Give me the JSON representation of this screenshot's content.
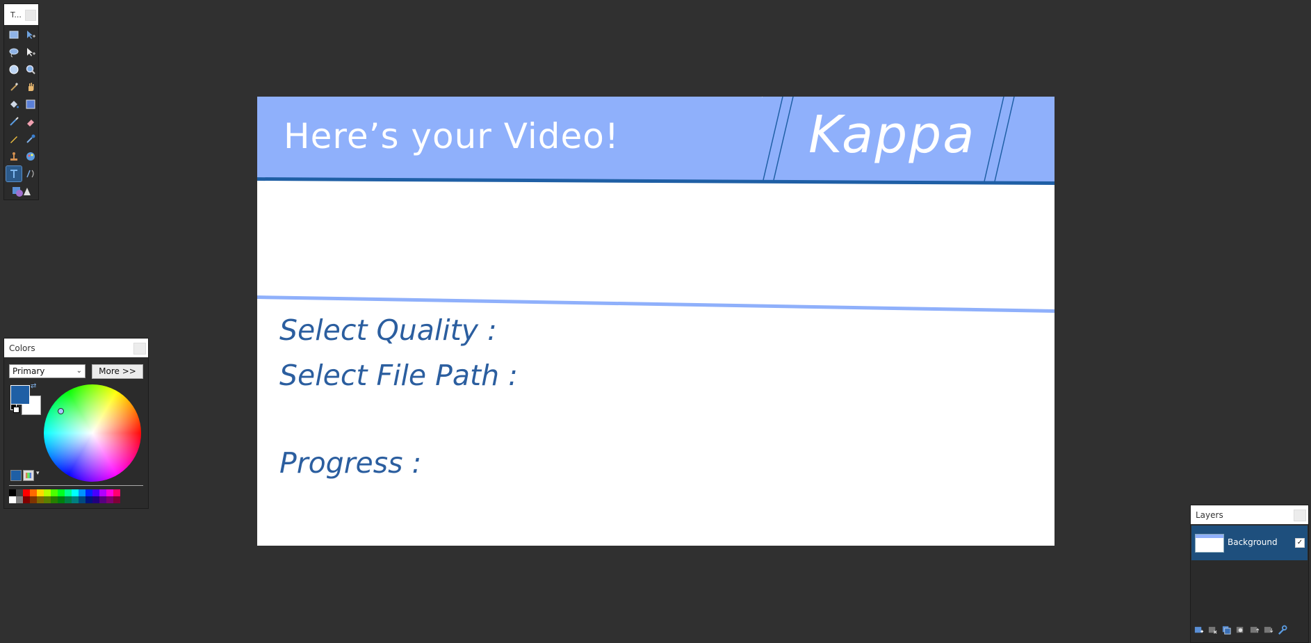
{
  "tools_window": {
    "title": "T...",
    "tools": [
      {
        "name": "rectangle-select-icon"
      },
      {
        "name": "move-selected-pixels-icon"
      },
      {
        "name": "lasso-select-icon"
      },
      {
        "name": "move-selection-icon"
      },
      {
        "name": "ellipse-select-icon"
      },
      {
        "name": "zoom-icon"
      },
      {
        "name": "magic-wand-icon"
      },
      {
        "name": "pan-icon"
      },
      {
        "name": "paint-bucket-icon"
      },
      {
        "name": "gradient-icon"
      },
      {
        "name": "paintbrush-icon"
      },
      {
        "name": "eraser-icon"
      },
      {
        "name": "pencil-icon"
      },
      {
        "name": "color-picker-icon"
      },
      {
        "name": "clone-stamp-icon"
      },
      {
        "name": "recolor-icon"
      },
      {
        "name": "text-icon",
        "selected": true
      },
      {
        "name": "line-curve-icon"
      },
      {
        "name": "shapes-icon"
      }
    ]
  },
  "canvas": {
    "header_text": "Here’s your Video!",
    "brand_text": "Kappa",
    "labels": {
      "quality": "Select Quality :",
      "file_path": "Select File Path :",
      "progress": "Progress :"
    },
    "colors": {
      "header_bg": "#8fb0fb",
      "header_rule": "#1f5fa5",
      "label_text": "#2b5e9f"
    }
  },
  "colors_window": {
    "title": "Colors",
    "mode_select": "Primary",
    "more_button": "More >>",
    "primary_color": "#1f5fa5",
    "secondary_color": "#ffffff",
    "palette_top": [
      "#000000",
      "#404040",
      "#ff0000",
      "#ff6a00",
      "#ffd800",
      "#b6ff00",
      "#4cff00",
      "#00ff21",
      "#00ff90",
      "#00ffff",
      "#0094ff",
      "#0026ff",
      "#4800ff",
      "#b200ff",
      "#ff00dc",
      "#ff006e"
    ],
    "palette_bottom": [
      "#ffffff",
      "#808080",
      "#7f0000",
      "#7f3300",
      "#7f6a00",
      "#5b7f00",
      "#267f00",
      "#007f0e",
      "#007f46",
      "#007f7f",
      "#004a7f",
      "#00137f",
      "#21007f",
      "#57007f",
      "#7f006e",
      "#7f0037"
    ]
  },
  "layers_window": {
    "title": "Layers",
    "layers": [
      {
        "name": "Background",
        "visible": true
      }
    ],
    "toolbar": [
      {
        "name": "add-layer-icon"
      },
      {
        "name": "delete-layer-icon"
      },
      {
        "name": "duplicate-layer-icon"
      },
      {
        "name": "merge-layer-icon"
      },
      {
        "name": "move-layer-up-icon"
      },
      {
        "name": "move-layer-down-icon"
      },
      {
        "name": "layer-properties-icon"
      }
    ]
  }
}
